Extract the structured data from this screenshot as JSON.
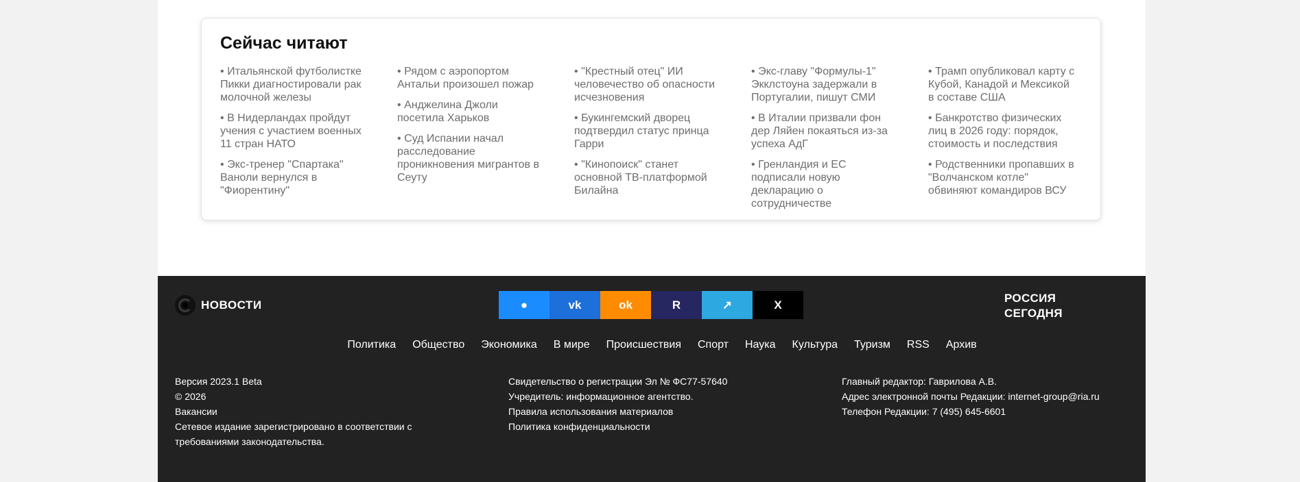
{
  "reading_now": {
    "title": "Сейчас читают",
    "bullet": "•",
    "columns": [
      [
        "Итальянской футболистке Пикки диагностировали рак молочной железы",
        "В Нидерландах пройдут учения с участием военных 11 стран НАТО",
        "Экс-тренер \"Спартака\" Ваноли вернулся в \"Фиорентину\""
      ],
      [
        "Рядом с аэропортом Антальи произошел пожар",
        "Анджелина Джоли посетила Харьков",
        "Суд Испании начал расследование проникновения мигрантов в Сеуту"
      ],
      [
        "\"Крестный отец\" ИИ человечество об опасности исчезновения",
        "Букингемский дворец подтвердил статус принца Гарри",
        "\"Кинопоиск\" станет основной ТВ-платформой Билайна"
      ],
      [
        "Экс-главу \"Формулы-1\" Экклстоуна задержали в Португалии, пишут СМИ",
        "В Италии призвали фон дер Ляйен покаяться из-за успеха АдГ",
        "Гренландия и ЕС подписали новую декларацию о сотрудничестве"
      ],
      [
        "Трамп опубликовал карту с Кубой, Канадой и Мексикой в составе США",
        "Банкротство физических лиц в 2026 году: порядок, стоимость и последствия",
        "Родственники пропавших в \"Волчанском котле\" обвиняют командиров ВСУ"
      ]
    ]
  },
  "footer": {
    "brand_name": "НОВОСТИ",
    "socials": [
      {
        "icon": "circle-dot-icon",
        "label": "●",
        "color": "#1a8cff"
      },
      {
        "icon": "vk-icon",
        "label": "vk",
        "color": "#1d6fd9"
      },
      {
        "icon": "ok-icon",
        "label": "ok",
        "color": "#ff8c00"
      },
      {
        "icon": "r-icon",
        "label": "R",
        "color": "#262660"
      },
      {
        "icon": "telegram-icon",
        "label": "↗",
        "color": "#2ea8e0"
      },
      {
        "icon": "x-icon",
        "label": "X",
        "color": "#000000"
      }
    ],
    "partner_logo": [
      "РОССИЯ",
      "СЕГОДНЯ"
    ],
    "nav": [
      "Политика",
      "Общество",
      "Экономика",
      "В мире",
      "Происшествия",
      "Спорт",
      "Наука",
      "Культура",
      "Туризм",
      "RSS",
      "Архив"
    ],
    "info_col_1": {
      "version": "Версия 2023.1 Beta",
      "copyright": "© 2026",
      "vacancies": "Вакансии",
      "registered_line1": "Сетевое издание зарегистрировано в соответствии с",
      "registered_line2": "требованиями законодательства."
    },
    "info_col_2": {
      "certificate": "Свидетельство о регистрации Эл № ФС77-57640",
      "founder": "Учредитель: информационное агентство.",
      "rules": "Правила использования материалов",
      "privacy": "Политика конфиденциальности"
    },
    "info_col_3": {
      "editor": "Главный редактор: Гаврилова А.В.",
      "email": "Адрес электронной почты Редакции: internet-group@ria.ru",
      "phone": "Телефон Редакции: 7 (495) 645-6601"
    }
  }
}
